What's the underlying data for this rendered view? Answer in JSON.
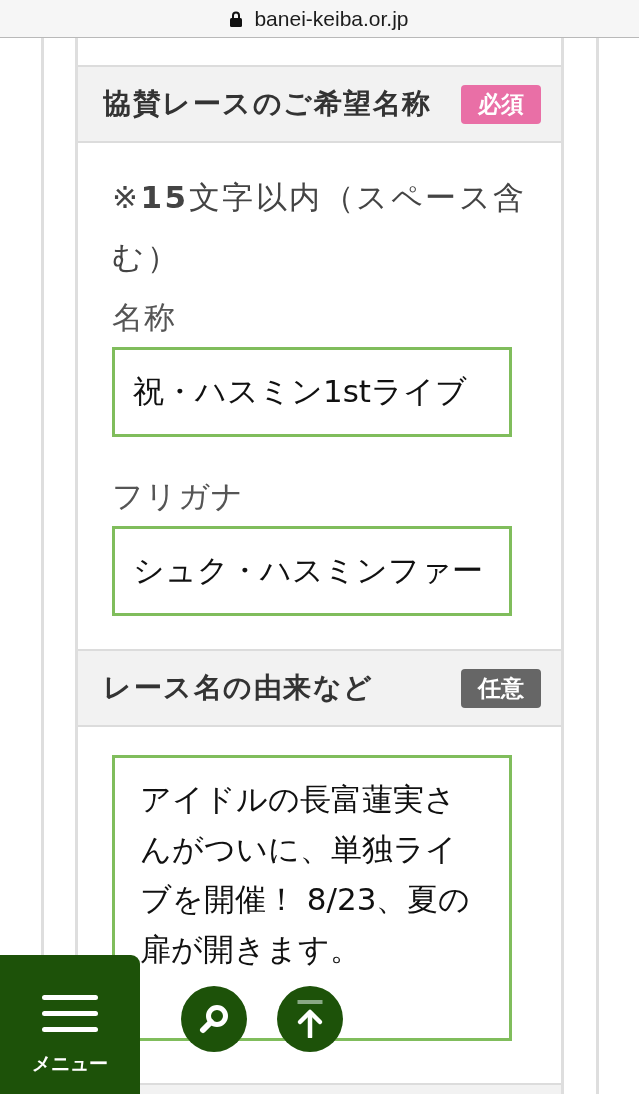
{
  "address_bar": {
    "url": "banei-keiba.or.jp"
  },
  "sections": [
    {
      "title": "協賛レースのご希望名称",
      "badge": {
        "label": "必須",
        "kind": "required"
      },
      "notice": "※**15**文字以内（スペース含む）",
      "fields": [
        {
          "kind": "input",
          "label": "名称",
          "value": "祝・ハスミン1stライブ"
        },
        {
          "kind": "input",
          "label": "フリガナ",
          "value": "シュク・ハスミンファー"
        }
      ]
    },
    {
      "title": "レース名の由来など",
      "badge": {
        "label": "任意",
        "kind": "optional"
      },
      "fields": [
        {
          "kind": "textarea",
          "value": "アイドルの長富蓮実さんがついに、単独ライブを開催！ 8/23、夏の扉が開きます。"
        }
      ]
    }
  ],
  "menu_button": {
    "label": "メニュー"
  }
}
